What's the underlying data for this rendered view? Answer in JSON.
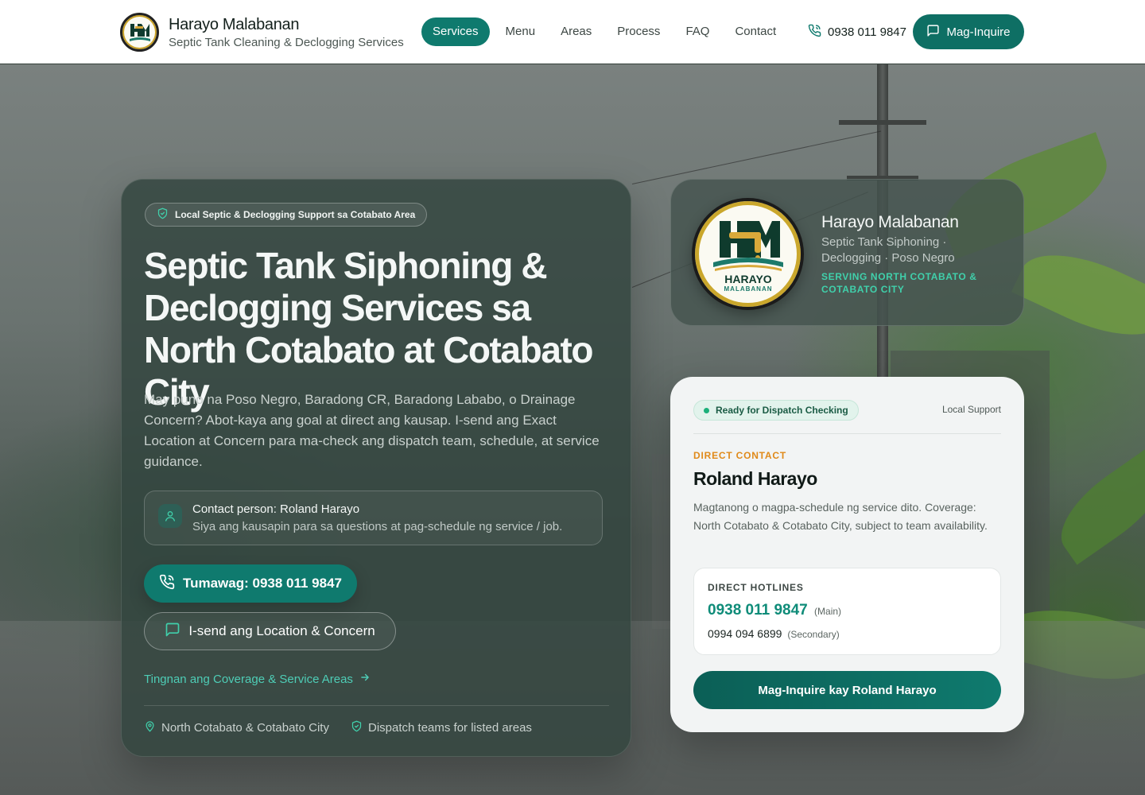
{
  "header": {
    "brand_name": "Harayo Malabanan",
    "brand_tagline": "Septic Tank Cleaning & Declogging Services",
    "nav": [
      {
        "label": "Services",
        "active": true
      },
      {
        "label": "Menu"
      },
      {
        "label": "Areas"
      },
      {
        "label": "Process"
      },
      {
        "label": "FAQ"
      },
      {
        "label": "Contact"
      }
    ],
    "phone": "0938 011 9847",
    "cta_label": "Mag-Inquire"
  },
  "hero": {
    "badge": "Local Septic & Declogging Support sa Cotabato Area",
    "title": "Septic Tank Siphoning & Declogging Services sa North Cotabato at Cotabato City",
    "description": "May puno na Poso Negro, Baradong CR, Baradong Lababo, o Drainage Concern? Abot-kaya ang goal at direct ang kausap. I-send ang Exact Location at Concern para ma-check ang dispatch team, schedule, at service guidance.",
    "contact_person": "Contact person: Roland Harayo",
    "contact_note": "Siya ang kausapin para sa questions at pag-schedule ng service / job.",
    "call_button": "Tumawag: 0938 011 9847",
    "send_button": "I-send ang Location & Concern",
    "coverage_link": "Tingnan ang Coverage & Service Areas",
    "footer_location": "North Cotabato & Cotabato City",
    "footer_dispatch": "Dispatch teams for listed areas"
  },
  "brand_card": {
    "name": "Harayo Malabanan",
    "services": "Septic Tank Siphoning · Declogging · Poso Negro",
    "serving": "SERVING NORTH COTABATO & COTABATO CITY",
    "logo_text": "HARAYO",
    "logo_subtext": "MALABANAN"
  },
  "contact_card": {
    "status": "Ready for Dispatch Checking",
    "support": "Local Support",
    "eyebrow": "DIRECT CONTACT",
    "name": "Roland Harayo",
    "description": "Magtanong o magpa-schedule ng service dito. Coverage: North Cotabato & Cotabato City, subject to team availability.",
    "hotlines_title": "DIRECT HOTLINES",
    "main_number": "0938 011 9847",
    "main_label": "(Main)",
    "secondary_number": "0994 094 6899",
    "secondary_label": "(Secondary)",
    "cta": "Mag-Inquire kay Roland Harayo"
  },
  "colors": {
    "accent": "#0f7a6e",
    "accent_light": "#40d0ab",
    "eyebrow": "#e08a1a"
  }
}
